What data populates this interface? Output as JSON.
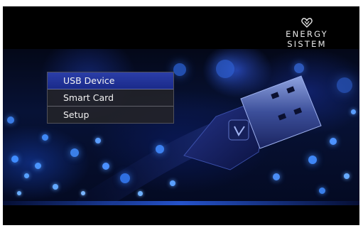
{
  "brand": {
    "name": "ENERGY SISTEM",
    "logo_icon": "heart-icon"
  },
  "menu": {
    "items": [
      {
        "label": "USB Device",
        "selected": true
      },
      {
        "label": "Smart Card",
        "selected": false
      },
      {
        "label": "Setup",
        "selected": false
      }
    ]
  },
  "colors": {
    "selected": "#2b3ea8",
    "menu_bg": "#232328",
    "accent_glow": "#2f5fe0"
  }
}
